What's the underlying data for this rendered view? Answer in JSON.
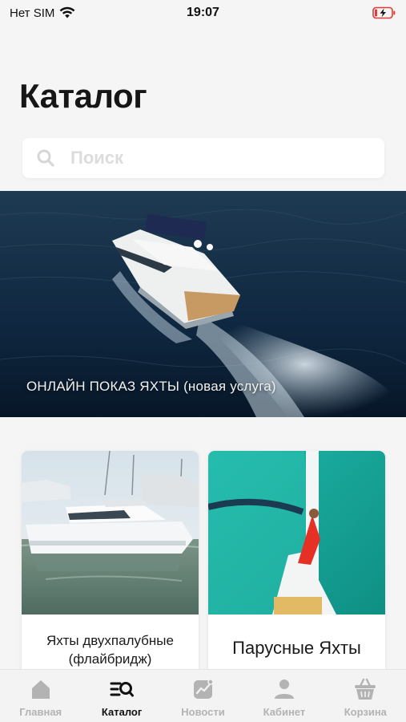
{
  "status_bar": {
    "carrier": "Нет SIM",
    "time": "19:07"
  },
  "header": {
    "title": "Каталог"
  },
  "search": {
    "placeholder": "Поиск"
  },
  "hero": {
    "caption": "ОНЛАЙН ПОКАЗ ЯХТЫ (новая услуга)"
  },
  "categories": [
    {
      "label_line1": "Яхты двухпалубные",
      "label_line2": "(флайбридж)"
    },
    {
      "label": "Парусные Яхты"
    }
  ],
  "tab_bar": {
    "active": "Каталог",
    "items": [
      {
        "label": "Главная",
        "icon": "home-icon"
      },
      {
        "label": "Каталог",
        "icon": "catalog-icon"
      },
      {
        "label": "Новости",
        "icon": "news-icon"
      },
      {
        "label": "Кабинет",
        "icon": "profile-icon"
      },
      {
        "label": "Корзина",
        "icon": "cart-icon"
      }
    ]
  },
  "colors": {
    "background": "#f5f5f5",
    "active_tab": "#111111",
    "inactive_tab": "#b3b3b3",
    "battery_charging": "#e53935"
  }
}
